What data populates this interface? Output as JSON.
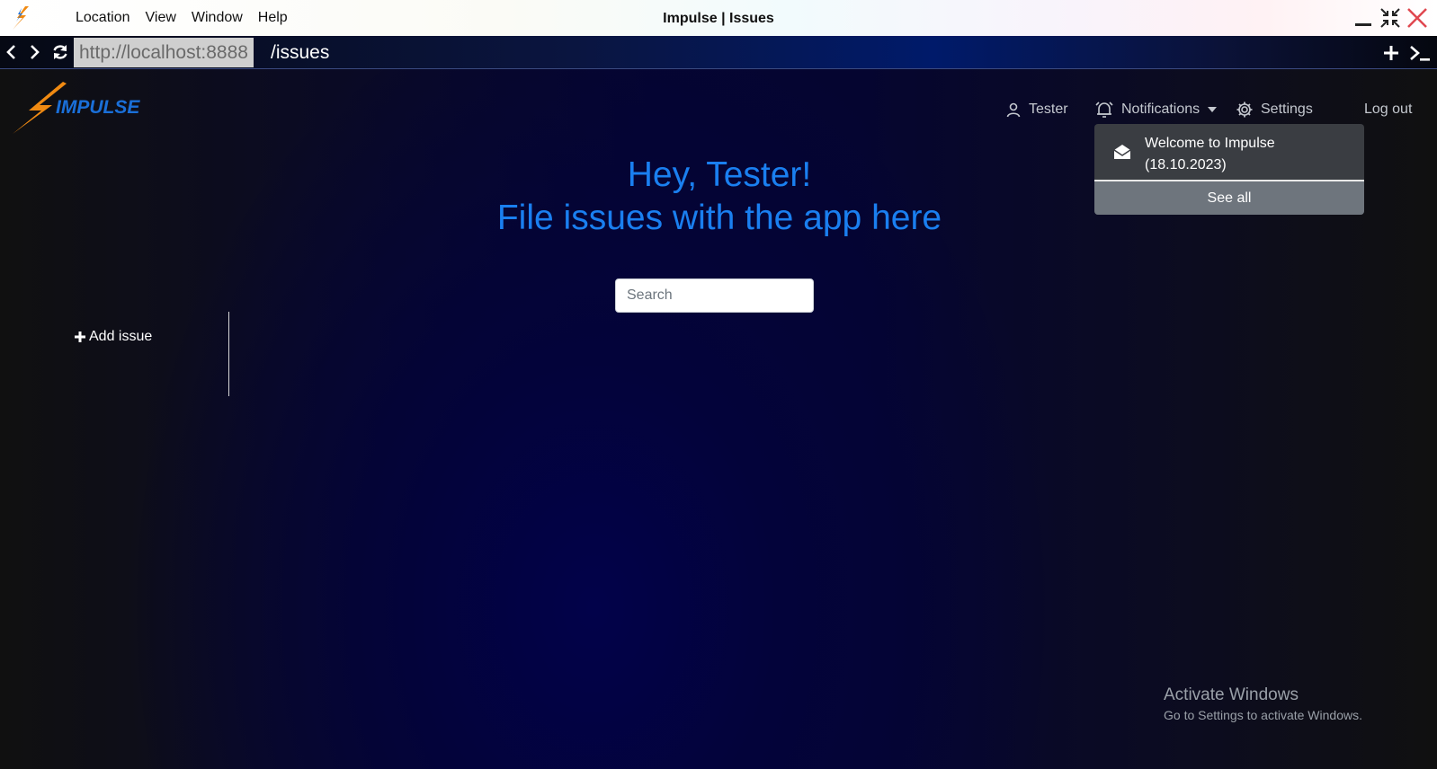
{
  "window": {
    "title": "Impulse | Issues",
    "menu": [
      "Location",
      "View",
      "Window",
      "Help"
    ]
  },
  "addressbar": {
    "url_base": "http://localhost:8888",
    "url_path": "/issues"
  },
  "app": {
    "brand": "IMPULSE",
    "nav": {
      "user": "Tester",
      "notifications": "Notifications",
      "settings": "Settings",
      "logout": "Log out"
    },
    "notifications_dropdown": {
      "items": [
        {
          "text": "Welcome to Impulse  (18.10.2023)",
          "icon": "envelope-open-icon"
        }
      ],
      "see_all": "See all"
    },
    "greeting": {
      "line1": "Hey, Tester!",
      "line2": "File issues with the app here"
    },
    "search": {
      "placeholder": "Search",
      "value": ""
    },
    "sidebar": {
      "add_issue": "Add issue"
    }
  },
  "watermark": {
    "title": "Activate Windows",
    "subtitle": "Go to Settings to activate Windows."
  },
  "colors": {
    "accent": "#1a7ff0",
    "brand_orange": "#f08a12",
    "brand_blue": "#1a6fd8",
    "dropdown_bg": "#3a3d42",
    "see_all_bg": "#6e757d",
    "close_red": "#e0474f"
  }
}
